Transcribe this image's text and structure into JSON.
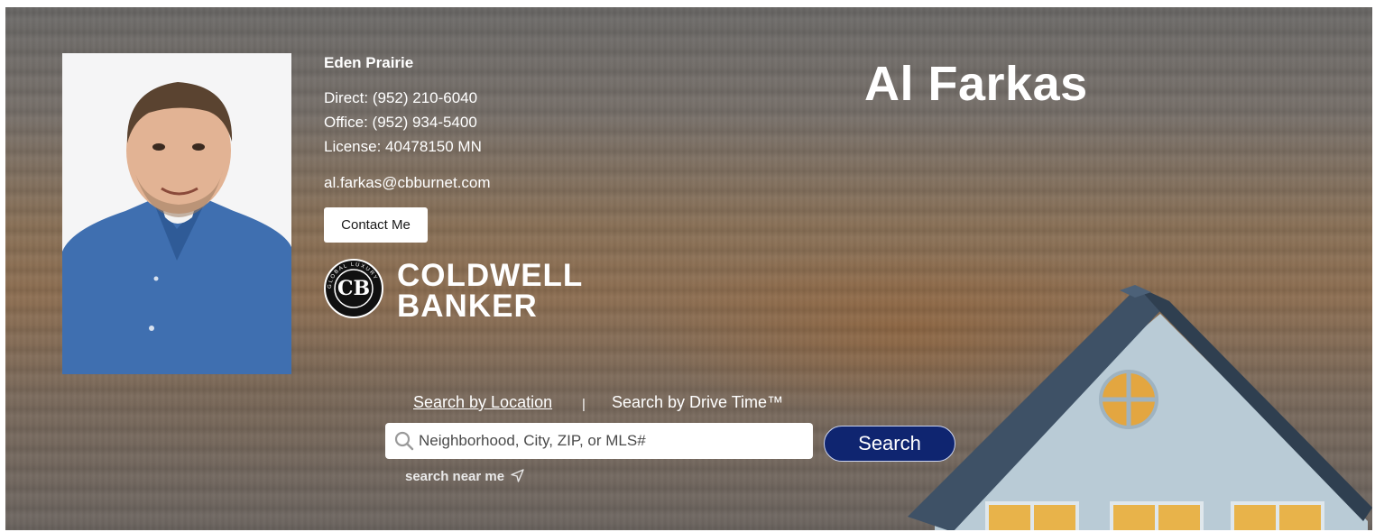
{
  "agent": {
    "name": "Al Farkas",
    "office_name": "Eden Prairie",
    "direct": "Direct: (952) 210-6040",
    "office": "Office: (952) 934-5400",
    "license": "License: 40478150 MN",
    "email": "al.farkas@cbburnet.com",
    "contact_button": "Contact Me"
  },
  "brand": {
    "logo_word_1": "COLDWELL",
    "logo_word_2": "BANKER",
    "badge_initials": "CB",
    "badge_ring_text": "GLOBAL LUXURY"
  },
  "search": {
    "tabs": [
      {
        "label": "Search by Location",
        "active": true
      },
      {
        "label": "Search by Drive Time™",
        "active": false
      }
    ],
    "divider": "|",
    "placeholder": "Neighborhood, City, ZIP, or MLS#",
    "button_label": "Search",
    "near_me_label": "search near me"
  },
  "icons": {
    "search": "search-icon",
    "near_me": "location-arrow-icon",
    "logo": "coldwell-banker-logo"
  },
  "colors": {
    "search_button": "#0f2570",
    "text": "#ffffff"
  }
}
